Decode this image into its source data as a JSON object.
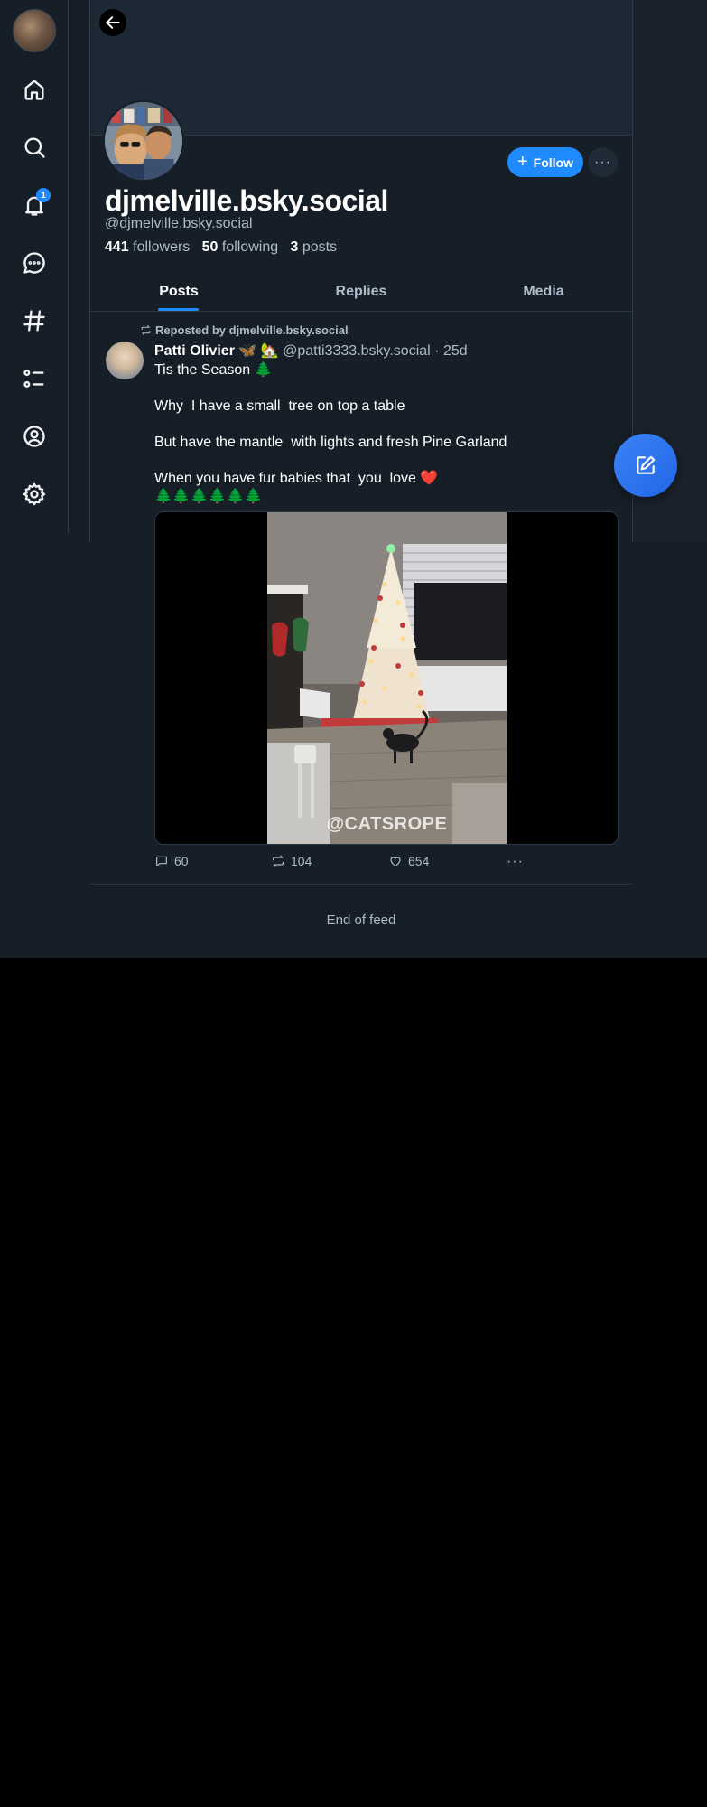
{
  "nav": {
    "notifications_badge": "1",
    "items": [
      "home",
      "search",
      "notifications",
      "chat",
      "feeds",
      "lists",
      "profile",
      "settings"
    ]
  },
  "profile": {
    "display_name": "djmelville.bsky.social",
    "handle": "@djmelville.bsky.social",
    "followers_count": "441",
    "followers_label": "followers",
    "following_count": "50",
    "following_label": "following",
    "posts_count": "3",
    "posts_label": "posts",
    "follow_label": "Follow",
    "more_label": "···"
  },
  "tabs": [
    {
      "label": "Posts",
      "active": true
    },
    {
      "label": "Replies",
      "active": false
    },
    {
      "label": "Media",
      "active": false
    }
  ],
  "post": {
    "repost_text": "Reposted by djmelville.bsky.social",
    "author_name": "Patti Olivier",
    "author_emojis": "🦋 🏡",
    "author_handle": "@patti3333.bsky.social",
    "time_separator": "·",
    "timestamp": "25d",
    "lines": [
      "Tis the Season 🌲",
      "Why  I have a small  tree on top a table",
      "But have the mantle  with lights and fresh Pine Garland",
      "When you have fur babies that  you  love ❤️",
      "🌲🌲🌲🌲🌲🌲"
    ],
    "video_watermark": "@CATSROPE",
    "reply_count": "60",
    "repost_count": "104",
    "like_count": "654",
    "more_label": "···"
  },
  "feed": {
    "end_text": "End of feed"
  },
  "colors": {
    "accent": "#208bfe",
    "background": "#161e27",
    "muted_text": "#aebbc9"
  }
}
